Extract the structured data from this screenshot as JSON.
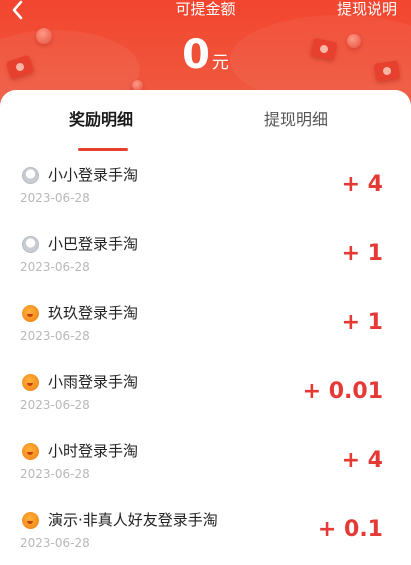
{
  "header": {
    "back_icon": "chevron-left-icon",
    "title": "可提金额",
    "help_label": "提现说明",
    "balance": "0",
    "balance_unit": "元"
  },
  "tabs": [
    {
      "label": "奖励明细",
      "active": true
    },
    {
      "label": "提现明细",
      "active": false
    }
  ],
  "records": [
    {
      "avatar": "gray-avatar-icon",
      "name": "小小登录手淘",
      "date": "2023-06-28",
      "amount": "+ 4"
    },
    {
      "avatar": "gray-avatar-icon",
      "name": "小巴登录手淘",
      "date": "2023-06-28",
      "amount": "+ 1"
    },
    {
      "avatar": "orange-avatar-icon",
      "name": "玖玖登录手淘",
      "date": "2023-06-28",
      "amount": "+ 1"
    },
    {
      "avatar": "orange-avatar-icon",
      "name": "小雨登录手淘",
      "date": "2023-06-28",
      "amount": "+ 0.01"
    },
    {
      "avatar": "orange-avatar-icon",
      "name": "小时登录手淘",
      "date": "2023-06-28",
      "amount": "+ 4"
    },
    {
      "avatar": "orange-avatar-icon",
      "name": "演示·非真人好友登录手淘",
      "date": "2023-06-28",
      "amount": "+ 0.1"
    }
  ],
  "colors": {
    "brand_red": "#f3452f",
    "amount_red": "#e53935",
    "tab_indicator": "#e8402e"
  }
}
